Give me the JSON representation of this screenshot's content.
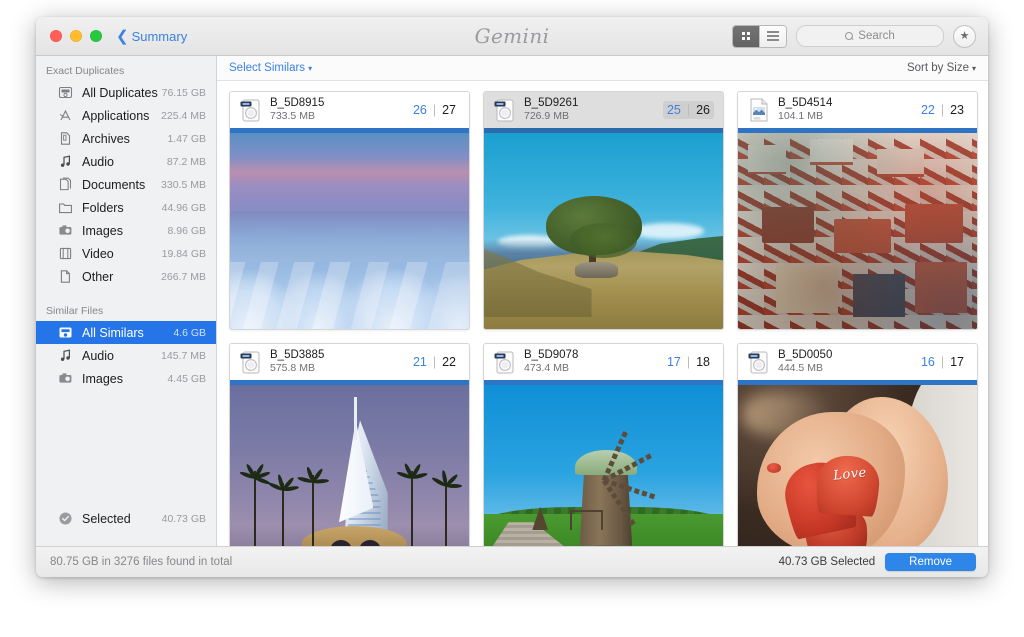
{
  "window": {
    "back_label": "Summary",
    "app_title": "Gemini",
    "traffic_lights": [
      "close-red",
      "minimize-yellow",
      "zoom-green"
    ]
  },
  "toolbar": {
    "view_grid_icon": "grid-view-icon",
    "view_list_icon": "list-view-icon",
    "search_placeholder": "Search",
    "star_glyph": "★"
  },
  "content_bar": {
    "select_similars": "Select Similars",
    "sort_by": "Sort by Size",
    "caret": "▾"
  },
  "sidebar": {
    "exact_header": "Exact Duplicates",
    "exact_items": [
      {
        "label": "All Duplicates",
        "size": "76.15 GB",
        "icon": "all-duplicates-icon"
      },
      {
        "label": "Applications",
        "size": "225.4 MB",
        "icon": "applications-icon"
      },
      {
        "label": "Archives",
        "size": "1.47 GB",
        "icon": "archives-icon"
      },
      {
        "label": "Audio",
        "size": "87.2 MB",
        "icon": "audio-icon"
      },
      {
        "label": "Documents",
        "size": "330.5 MB",
        "icon": "documents-icon"
      },
      {
        "label": "Folders",
        "size": "44.96 GB",
        "icon": "folders-icon"
      },
      {
        "label": "Images",
        "size": "8.96 GB",
        "icon": "images-icon"
      },
      {
        "label": "Video",
        "size": "19.84 GB",
        "icon": "video-icon"
      },
      {
        "label": "Other",
        "size": "266.7 MB",
        "icon": "other-icon"
      }
    ],
    "similar_header": "Similar Files",
    "similar_items": [
      {
        "label": "All Similars",
        "size": "4.6 GB",
        "icon": "all-similars-icon",
        "selected": true
      },
      {
        "label": "Audio",
        "size": "145.7 MB",
        "icon": "audio-icon",
        "selected": false
      },
      {
        "label": "Images",
        "size": "4.45 GB",
        "icon": "images-icon",
        "selected": false
      }
    ],
    "selected_row": {
      "label": "Selected",
      "size": "40.73 GB",
      "icon": "selected-check-icon"
    }
  },
  "cards": [
    {
      "name": "B_5D8915",
      "size": "733.5 MB",
      "selected_count": "26",
      "total_count": "27",
      "divider": "|",
      "icon": "washer-photo-icon",
      "hovered": false,
      "artwork": "snowy-mountains-dusk"
    },
    {
      "name": "B_5D9261",
      "size": "726.9 MB",
      "selected_count": "25",
      "total_count": "26",
      "divider": "|",
      "icon": "washer-photo-icon",
      "hovered": true,
      "artwork": "lone-tree-hillside"
    },
    {
      "name": "B_5D4514",
      "size": "104.1 MB",
      "selected_count": "22",
      "total_count": "23",
      "divider": "|",
      "icon": "jpeg-document-icon",
      "hovered": false,
      "artwork": "city-red-rooftops"
    },
    {
      "name": "B_5D3885",
      "size": "575.8 MB",
      "selected_count": "21",
      "total_count": "22",
      "divider": "|",
      "icon": "washer-photo-icon",
      "hovered": false,
      "artwork": "burj-al-arab-dusk"
    },
    {
      "name": "B_5D9078",
      "size": "473.4 MB",
      "selected_count": "17",
      "total_count": "18",
      "divider": "|",
      "icon": "washer-photo-icon",
      "hovered": false,
      "artwork": "wooden-windmill"
    },
    {
      "name": "B_5D0050",
      "size": "444.5 MB",
      "selected_count": "16",
      "total_count": "17",
      "divider": "|",
      "icon": "washer-photo-icon",
      "hovered": false,
      "artwork": "hands-love-hearts"
    }
  ],
  "artwork_text": {
    "love_word": "Love"
  },
  "footer": {
    "total_text": "80.75 GB in 3276 files found in total",
    "selected_text": "40.73 GB Selected",
    "remove_label": "Remove"
  },
  "colors": {
    "accent_blue": "#2575e8",
    "link_blue": "#3b82e0",
    "remove_blue": "#2e86e8",
    "selection_bar": "#2e74c4",
    "sidebar_bg": "#f0f1f3"
  }
}
